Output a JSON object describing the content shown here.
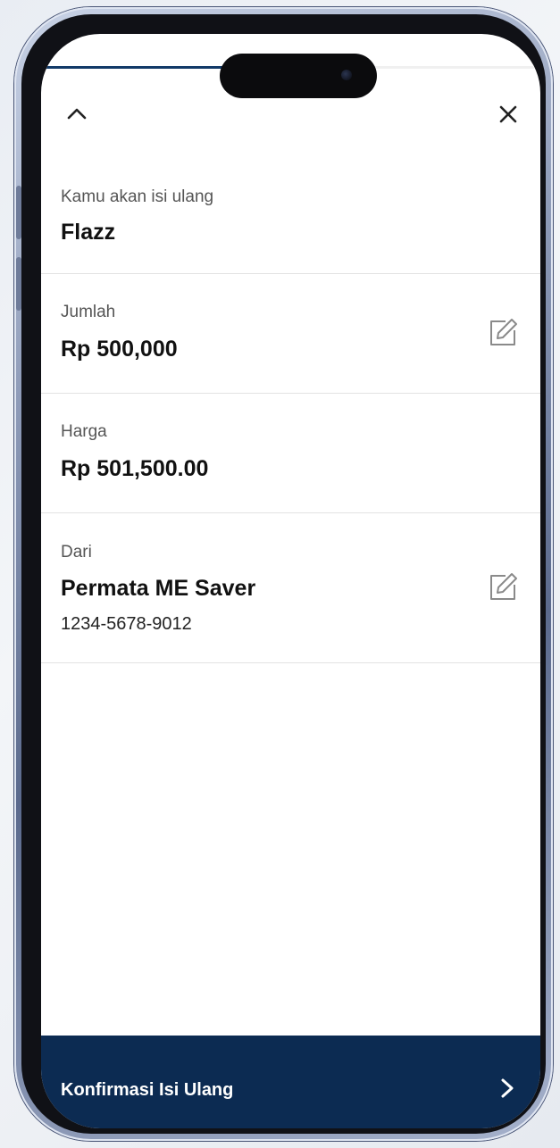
{
  "progress": {
    "value": 0.37
  },
  "header": {
    "collapse_icon": "chevron-up-icon",
    "close_icon": "close-icon"
  },
  "topup": {
    "label": "Kamu akan isi ulang",
    "value": "Flazz"
  },
  "amount": {
    "label": "Jumlah",
    "value": "Rp 500,000",
    "edit_icon": "edit-icon"
  },
  "price": {
    "label": "Harga",
    "value": "Rp 501,500.00"
  },
  "source": {
    "label": "Dari",
    "account_name": "Permata ME Saver",
    "account_number": "1234-5678-9012",
    "edit_icon": "edit-icon"
  },
  "footer": {
    "confirm_label": "Konfirmasi Isi Ulang",
    "chevron_icon": "chevron-right-icon"
  },
  "colors": {
    "brand_navy": "#0c2b52",
    "progress": "#123a68"
  }
}
